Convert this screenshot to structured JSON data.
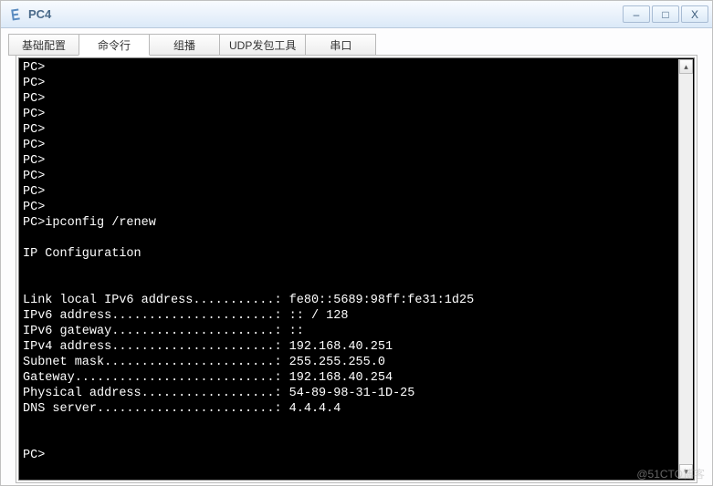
{
  "window": {
    "title": "PC4",
    "buttons": {
      "min": "–",
      "max": "□",
      "close": "X"
    }
  },
  "tabs": [
    {
      "label": "基础配置",
      "active": false
    },
    {
      "label": "命令行",
      "active": true
    },
    {
      "label": "组播",
      "active": false
    },
    {
      "label": "UDP发包工具",
      "active": false
    },
    {
      "label": "串口",
      "active": false
    }
  ],
  "terminal": {
    "prompt": "PC>",
    "lines": [
      "PC>",
      "PC>",
      "PC>",
      "PC>",
      "PC>",
      "PC>",
      "PC>",
      "PC>",
      "PC>",
      "PC>",
      "PC>ipconfig /renew",
      "",
      "IP Configuration",
      "",
      "",
      "Link local IPv6 address...........: fe80::5689:98ff:fe31:1d25",
      "IPv6 address......................: :: / 128",
      "IPv6 gateway......................: ::",
      "IPv4 address......................: 192.168.40.251",
      "Subnet mask.......................: 255.255.255.0",
      "Gateway...........................: 192.168.40.254",
      "Physical address..................: 54-89-98-31-1D-25",
      "DNS server........................: 4.4.4.4",
      "",
      "",
      "PC>"
    ]
  },
  "watermark": "@51CTO博客"
}
